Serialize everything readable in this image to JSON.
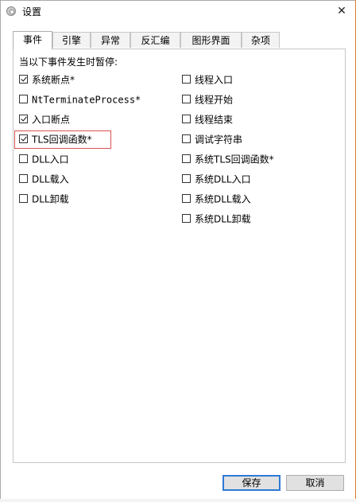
{
  "window": {
    "title": "设置",
    "close_glyph": "✕"
  },
  "tabs": [
    {
      "label": "事件",
      "active": true
    },
    {
      "label": "引擎",
      "active": false
    },
    {
      "label": "异常",
      "active": false
    },
    {
      "label": "反汇编",
      "active": false
    },
    {
      "label": "图形界面",
      "active": false
    },
    {
      "label": "杂项",
      "active": false
    }
  ],
  "events": {
    "group_label": "当以下事件发生时暂停:",
    "left_column": [
      {
        "label": "系统断点*",
        "checked": true
      },
      {
        "label": "NtTerminateProcess*",
        "checked": false
      },
      {
        "label": "入口断点",
        "checked": true
      },
      {
        "label": "TLS回调函数*",
        "checked": true,
        "highlighted": true
      },
      {
        "label": "DLL入口",
        "checked": false
      },
      {
        "label": "DLL载入",
        "checked": false
      },
      {
        "label": "DLL卸载",
        "checked": false
      }
    ],
    "right_column": [
      {
        "label": "线程入口",
        "checked": false
      },
      {
        "label": "线程开始",
        "checked": false
      },
      {
        "label": "线程结束",
        "checked": false
      },
      {
        "label": "调试字符串",
        "checked": false
      },
      {
        "label": "系统TLS回调函数*",
        "checked": false
      },
      {
        "label": "系统DLL入口",
        "checked": false
      },
      {
        "label": "系统DLL载入",
        "checked": false
      },
      {
        "label": "系统DLL卸载",
        "checked": false
      }
    ]
  },
  "buttons": {
    "save": "保存",
    "cancel": "取消"
  },
  "colors": {
    "highlight_border": "#d9534f",
    "primary_border": "#2f7ad6",
    "button_bg": "#e1e1e1"
  }
}
